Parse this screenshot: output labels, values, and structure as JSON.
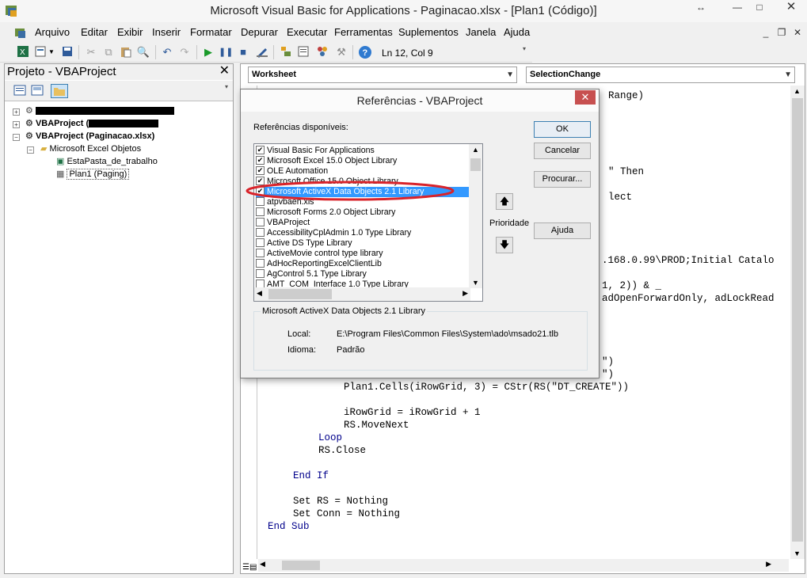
{
  "window": {
    "title": "Microsoft Visual Basic for Applications - Paginacao.xlsx - [Plan1 (Código)]"
  },
  "menu": [
    {
      "label": "Arquivo"
    },
    {
      "label": "Editar"
    },
    {
      "label": "Exibir"
    },
    {
      "label": "Inserir"
    },
    {
      "label": "Formatar"
    },
    {
      "label": "Depurar"
    },
    {
      "label": "Executar"
    },
    {
      "label": "Ferramentas"
    },
    {
      "label": "Suplementos"
    },
    {
      "label": "Janela"
    },
    {
      "label": "Ajuda"
    }
  ],
  "toolbar": {
    "position": "Ln 12, Col 9"
  },
  "project": {
    "title": "Projeto - VBAProject",
    "tree": [
      {
        "label": "",
        "redacted": true
      },
      {
        "label": "VBAProject (",
        "redacted": true
      },
      {
        "label": "VBAProject (Paginacao.xlsx)"
      },
      {
        "label": "Microsoft Excel Objetos"
      },
      {
        "label": "EstaPasta_de_trabalho"
      },
      {
        "label": "Plan1 (Paging)"
      }
    ]
  },
  "code": {
    "object": "Worksheet",
    "procedure": "SelectionChange",
    "lines": [
      {
        "text": "Range)"
      },
      {
        "text": "\" Then"
      },
      {
        "text": "lect"
      },
      {
        "text": ".168.0.99\\PROD;Initial Catalo"
      },
      {
        "text": "1, 2)) & _"
      },
      {
        "text": "adOpenForwardOnly, adLockRead"
      },
      {
        "text": "\")"
      },
      {
        "text": "\")"
      },
      {
        "text": "Plan1.Cells(iRowGrid, 3) = CStr(RS(\"DT_CREATE\"))"
      },
      {
        "text": "iRowGrid = iRowGrid + 1"
      },
      {
        "text": "RS.MoveNext"
      },
      {
        "text": "Loop"
      },
      {
        "text": "RS.Close"
      },
      {
        "text": "End If"
      },
      {
        "text": "Set RS = Nothing"
      },
      {
        "text": "Set Conn = Nothing"
      },
      {
        "text": "End Sub"
      }
    ]
  },
  "dialog": {
    "title": "Referências - VBAProject",
    "list_label": "Referências disponíveis:",
    "references": [
      {
        "label": "Visual Basic For Applications",
        "checked": true
      },
      {
        "label": "Microsoft Excel 15.0 Object Library",
        "checked": true
      },
      {
        "label": "OLE Automation",
        "checked": true
      },
      {
        "label": "Microsoft Office 15.0 Object Library",
        "checked": true
      },
      {
        "label": "Microsoft ActiveX Data Objects 2.1 Library",
        "checked": true,
        "selected": true
      },
      {
        "label": "atpvbaen.xls",
        "checked": false
      },
      {
        "label": "Microsoft Forms 2.0 Object Library",
        "checked": false
      },
      {
        "label": "VBAProject",
        "checked": false
      },
      {
        "label": "AccessibilityCplAdmin 1.0 Type Library",
        "checked": false
      },
      {
        "label": "Active DS Type Library",
        "checked": false
      },
      {
        "label": "ActiveMovie control type library",
        "checked": false
      },
      {
        "label": "AdHocReportingExcelClientLib",
        "checked": false
      },
      {
        "label": "AgControl 5.1 Type Library",
        "checked": false
      },
      {
        "label": "AMT_COM_Interface 1.0 Type Library",
        "checked": false
      }
    ],
    "buttons": {
      "ok": "OK",
      "cancel": "Cancelar",
      "browse": "Procurar...",
      "help": "Ajuda"
    },
    "priority_label": "Prioridade",
    "info": {
      "name": "Microsoft ActiveX Data Objects 2.1 Library",
      "location_label": "Local:",
      "location": "E:\\Program Files\\Common Files\\System\\ado\\msado21.tlb",
      "language_label": "Idioma:",
      "language": "Padrão"
    },
    "annotation_color": "#d9232a"
  }
}
